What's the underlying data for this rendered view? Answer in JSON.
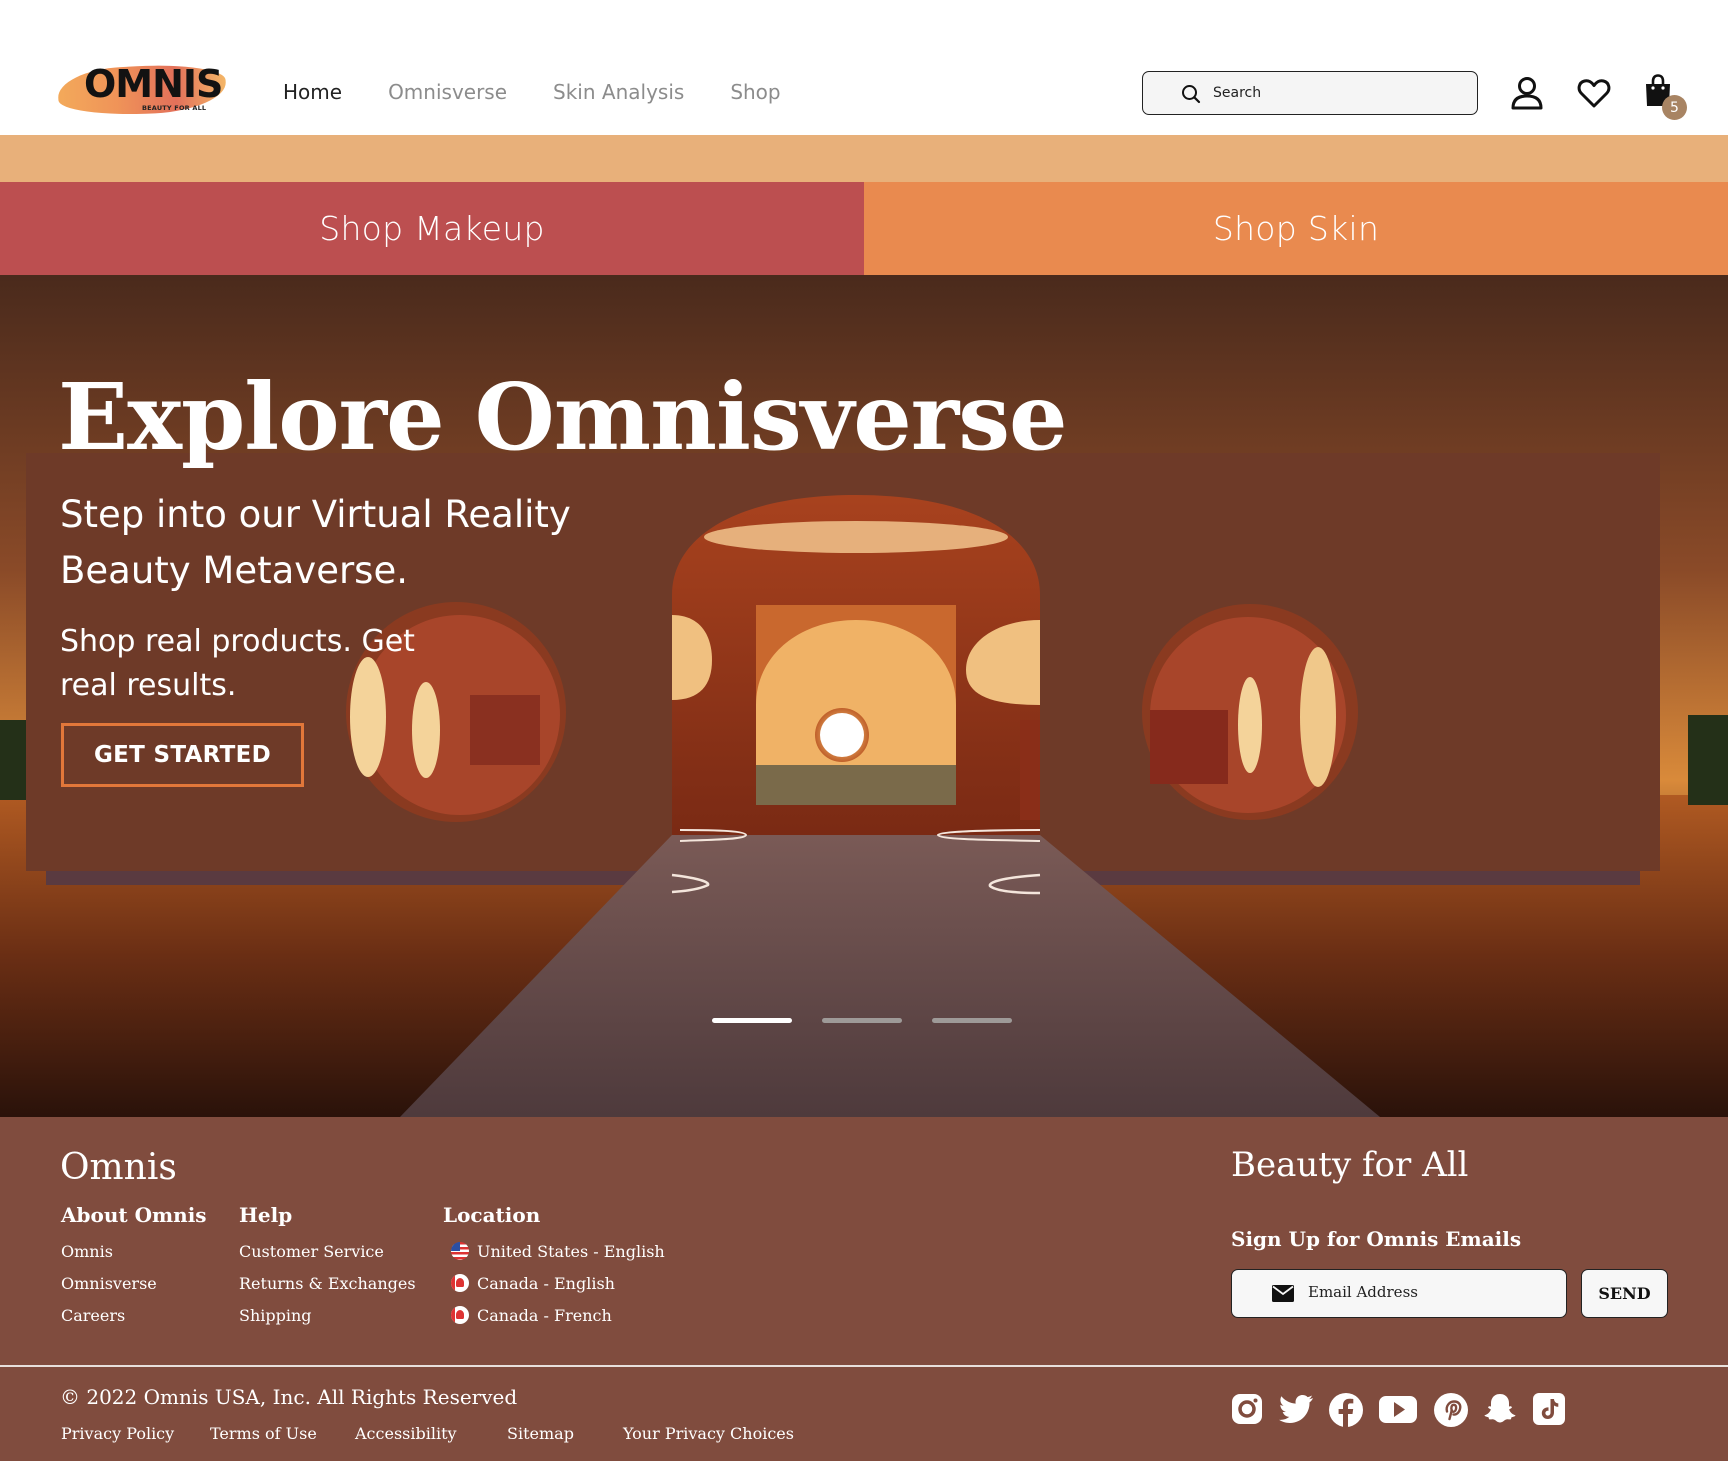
{
  "brand": {
    "logo_text": "OMNIS",
    "logo_tagline": "BEAUTY FOR ALL"
  },
  "nav": {
    "items": [
      {
        "label": "Home",
        "active": true
      },
      {
        "label": "Omnisverse",
        "active": false
      },
      {
        "label": "Skin Analysis",
        "active": false
      },
      {
        "label": "Shop",
        "active": false
      }
    ]
  },
  "search": {
    "placeholder": "Search",
    "icon": "search-icon"
  },
  "header_icons": {
    "account": "user-icon",
    "wishlist": "heart-icon",
    "cart": "shopping-bag-icon",
    "cart_count": "5"
  },
  "promo": {
    "makeup_label": "Shop Makeup",
    "skin_label": "Shop Skin",
    "colors": {
      "strip": "#e8b07a",
      "makeup": "#bc4f50",
      "skin": "#e98a4f"
    }
  },
  "hero": {
    "title": "Explore Omnisverse",
    "subtitle": "Step into our Virtual Reality Beauty Metaverse.",
    "tagline": "Shop real products. Get real results.",
    "cta_label": "GET STARTED",
    "slides": [
      {
        "active": true
      },
      {
        "active": false
      },
      {
        "active": false
      }
    ]
  },
  "footer": {
    "brand": "Omnis",
    "columns": {
      "about": {
        "heading": "About Omnis",
        "links": [
          "Omnis",
          "Omnisverse",
          "Careers"
        ]
      },
      "help": {
        "heading": "Help",
        "links": [
          "Customer Service",
          "Returns & Exchanges",
          "Shipping"
        ]
      },
      "location": {
        "heading": "Location",
        "links": [
          "United States - English",
          "Canada - English",
          "Canada - French"
        ]
      }
    },
    "tagline": "Beauty for All",
    "signup_heading": "Sign Up for Omnis Emails",
    "email_placeholder": "Email Address",
    "send_label": "SEND",
    "copyright": "2022 Omnis USA, Inc. All Rights Reserved",
    "legal_links": [
      "Privacy Policy",
      "Terms of Use",
      "Accessibility",
      "Sitemap",
      "Your Privacy Choices"
    ],
    "social": [
      "instagram-icon",
      "twitter-icon",
      "facebook-icon",
      "youtube-icon",
      "pinterest-icon",
      "snapchat-icon",
      "tiktok-icon"
    ],
    "colors": {
      "background": "#804c3e"
    }
  }
}
